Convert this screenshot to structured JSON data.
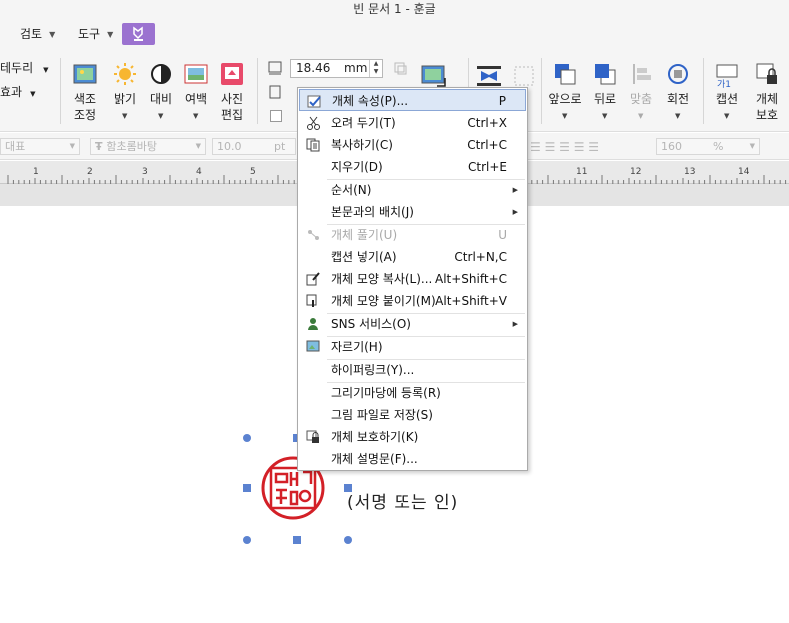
{
  "window": {
    "title": "빈 문서 1 - 훈글"
  },
  "menubar": {
    "items": [
      "검토",
      "도구"
    ]
  },
  "ribbon": {
    "left_cut": {
      "border": "테두리",
      "effect": "효과"
    },
    "buttons": {
      "color_adjust": [
        "색조",
        "조정"
      ],
      "brightness": "밝기",
      "contrast": "대비",
      "margin": "여백",
      "photo_edit": [
        "사진",
        "편집"
      ],
      "front": "앞으로",
      "back": "뒤로",
      "align": "맞춤",
      "rotate": "회전",
      "caption": "캡션",
      "protect": [
        "개체",
        "보호"
      ]
    },
    "size_value": "18.46",
    "size_unit": "mm",
    "caption_icon_text": "가1"
  },
  "format_bar": {
    "style": "대표",
    "font": "함초롬바탕",
    "size": "10.0",
    "size_unit": "pt",
    "zoom": "160",
    "zoom_unit": "%"
  },
  "ruler": {
    "numbers": [
      "1",
      "2",
      "3",
      "4",
      "5",
      "11",
      "12",
      "13",
      "14"
    ]
  },
  "context_menu": [
    {
      "label": "개체 속성(P)...",
      "shortcut": "P",
      "icon": "object-properties-icon",
      "highlight": true
    },
    {
      "label": "오려 두기(T)",
      "shortcut": "Ctrl+X",
      "icon": "scissors-icon"
    },
    {
      "label": "복사하기(C)",
      "shortcut": "Ctrl+C",
      "icon": "copy-icon"
    },
    {
      "label": "지우기(D)",
      "shortcut": "Ctrl+E"
    },
    {
      "label": "순서(N)",
      "submenu": true
    },
    {
      "label": "본문과의 배치(J)",
      "submenu": true
    },
    {
      "label": "개체 풀기(U)",
      "shortcut": "U",
      "icon": "ungroup-icon",
      "disabled": true
    },
    {
      "label": "캡션 넣기(A)",
      "shortcut": "Ctrl+N,C"
    },
    {
      "label": "개체 모양 복사(L)...",
      "shortcut": "Alt+Shift+C",
      "icon": "copy-format-icon"
    },
    {
      "label": "개체 모양 붙이기(M)",
      "shortcut": "Alt+Shift+V",
      "icon": "paste-format-icon"
    },
    {
      "label": "SNS 서비스(O)",
      "submenu": true,
      "icon": "sns-icon"
    },
    {
      "label": "자르기(H)",
      "icon": "crop-icon"
    },
    {
      "label": "하이퍼링크(Y)..."
    },
    {
      "label": "그리기마당에 등록(R)"
    },
    {
      "label": "그림 파일로 저장(S)"
    },
    {
      "label": "개체 보호하기(K)",
      "icon": "lock-icon"
    },
    {
      "label": "개체 설명문(F)..."
    }
  ],
  "document": {
    "seal_caption": "(서명 또는 인)"
  },
  "colors": {
    "seal_red": "#d32027",
    "handle_blue": "#5b82d0",
    "highlight": "#dce7f6",
    "purple_button": "#9b72d0"
  }
}
